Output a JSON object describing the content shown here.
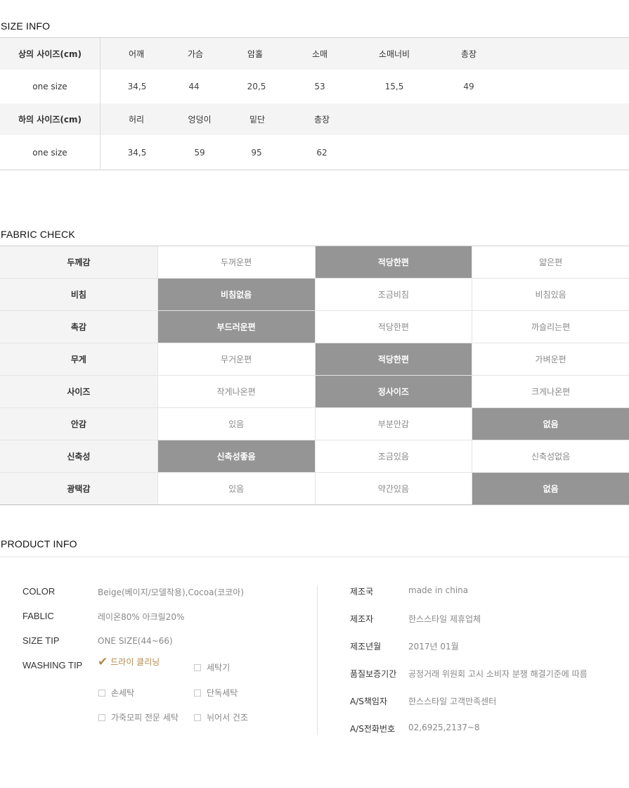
{
  "size_info": {
    "title": "SIZE INFO",
    "top": {
      "label": "상의 사이즈(cm)",
      "headers": [
        "어깨",
        "가슴",
        "암홀",
        "소매",
        "소매너비",
        "총장"
      ],
      "row_label": "one size",
      "values": [
        "34,5",
        "44",
        "20,5",
        "53",
        "15,5",
        "49"
      ]
    },
    "bottom": {
      "label": "하의 사이즈(cm)",
      "headers": [
        "허리",
        "엉덩이",
        "밑단",
        "총장"
      ],
      "row_label": "one size",
      "values": [
        "34,5",
        "59",
        "95",
        "62"
      ]
    }
  },
  "fabric_check": {
    "title": "FABRIC CHECK",
    "selected_color": "#959595",
    "rows": [
      {
        "label": "두께감",
        "options": [
          "두꺼운편",
          "적당한편",
          "얇은편"
        ],
        "selected": 1
      },
      {
        "label": "비침",
        "options": [
          "비침없음",
          "조금비침",
          "비침있음"
        ],
        "selected": 0
      },
      {
        "label": "촉감",
        "options": [
          "부드러운편",
          "적당한편",
          "까슬리는편"
        ],
        "selected": 0
      },
      {
        "label": "무게",
        "options": [
          "무거운편",
          "적당한편",
          "가벼운편"
        ],
        "selected": 1
      },
      {
        "label": "사이즈",
        "options": [
          "작게나온편",
          "정사이즈",
          "크게나온편"
        ],
        "selected": 1
      },
      {
        "label": "안감",
        "options": [
          "있음",
          "부분안감",
          "없음"
        ],
        "selected": 2
      },
      {
        "label": "신축성",
        "options": [
          "신축성좋음",
          "조금있음",
          "신축성없음"
        ],
        "selected": 0
      },
      {
        "label": "광택감",
        "options": [
          "있음",
          "약간있음",
          "없음"
        ],
        "selected": 2
      }
    ]
  },
  "product_info": {
    "title": "PRODUCT INFO",
    "color_label": "COLOR",
    "color_value": "Beige(베이지/모델착용),Cocoa(코코아)",
    "fablic_label": "FABLIC",
    "fablic_value": "레이온80% 아크릴20%",
    "size_tip_label": "SIZE TIP",
    "size_tip_value": "ONE SIZE(44~66)",
    "washing_tip_label": "WASHING TIP",
    "washing": [
      {
        "label": "드라이 클리닝",
        "checked": true
      },
      {
        "label": "세탁기",
        "checked": false
      },
      {
        "label": "손세탁",
        "checked": false
      },
      {
        "label": "단독세탁",
        "checked": false
      },
      {
        "label": "가죽모피 전문 세탁",
        "checked": false
      },
      {
        "label": "뉘어서 건조",
        "checked": false
      }
    ],
    "check_color": "#b08a4a",
    "right": [
      {
        "label": "제조국",
        "value": "made in china"
      },
      {
        "label": "제조자",
        "value": "한스스타일 제휴업체"
      },
      {
        "label": "제조년월",
        "value": "2017년 01월"
      },
      {
        "label": "품질보증기간",
        "value": "공정거래 위원회 고시 소비자 분쟁 해결기준에 따름"
      },
      {
        "label": "A/S책임자",
        "value": "한스스타일 고객만족센터"
      },
      {
        "label": "A/S전화번호",
        "value": "02,6925,2137~8"
      }
    ]
  }
}
